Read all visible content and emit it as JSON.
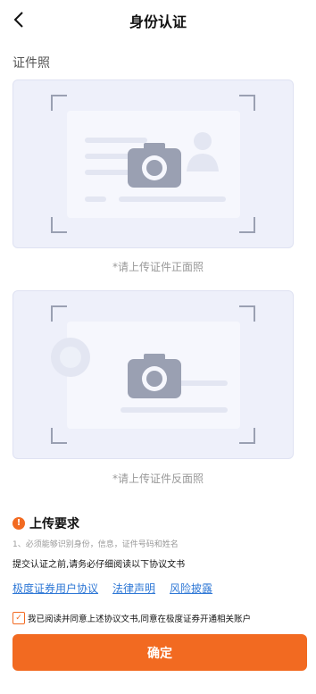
{
  "header": {
    "title": "身份认证"
  },
  "section": {
    "label": "证件照"
  },
  "cards": {
    "front_hint": "*请上传证件正面照",
    "back_hint": "*请上传证件反面照"
  },
  "requirements": {
    "title": "上传要求",
    "desc": "1、必须能够识别身份，信息，证件号码和姓名",
    "note": "提交认证之前,请务必仔细阅读以下协议文书"
  },
  "links": [
    {
      "label": "极度证券用户协议"
    },
    {
      "label": "法律声明"
    },
    {
      "label": "风险披露"
    }
  ],
  "agreement": {
    "checked": true,
    "text": "我已阅读并同意上述协议文书,同意在极度证券开通相关账户"
  },
  "actions": {
    "confirm": "确定"
  },
  "colors": {
    "accent": "#f26a21",
    "link": "#2f78d6"
  }
}
